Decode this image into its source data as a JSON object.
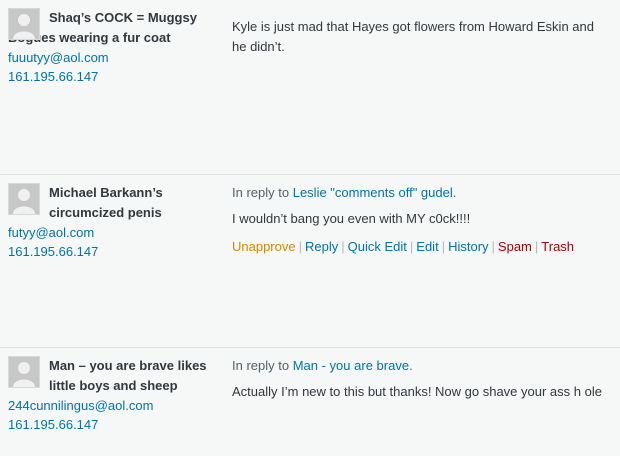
{
  "comments": [
    {
      "author": "Shaq’s COCK = Muggsy Bogues wearing a fur coat",
      "email": "fuuutyy@aol.com",
      "ip": "161.195.66.147",
      "reply_prefix": "",
      "reply_target": "",
      "text": "Kyle is just mad that Hayes got flowers from Howard Eskin and he didn’t."
    },
    {
      "author": "Michael Barkann’s circumcized penis",
      "email": "futyy@aol.com",
      "ip": "161.195.66.147",
      "reply_prefix": "In reply to",
      "reply_target": "Leslie \"comments off\" gudel",
      "text": "I wouldn’t bang you even with MY c0ck!!!!"
    },
    {
      "author": "Man – you are brave likes little boys and sheep",
      "email": "244cunnilingus@aol.com",
      "ip": "161.195.66.147",
      "reply_prefix": "In reply to",
      "reply_target": "Man - you are brave",
      "text": "Actually I’m new to this but thanks! Now go shave your ass h ole"
    }
  ],
  "row_actions": {
    "unapprove": "Unapprove",
    "reply": "Reply",
    "quick_edit": "Quick Edit",
    "edit": "Edit",
    "history": "History",
    "spam": "Spam",
    "trash": "Trash",
    "separator": "|",
    "period": "."
  },
  "colors": {
    "link": "#0073aa",
    "unapprove": "#d98500",
    "danger": "#aa0000",
    "avatar": "#c7c7c7"
  }
}
